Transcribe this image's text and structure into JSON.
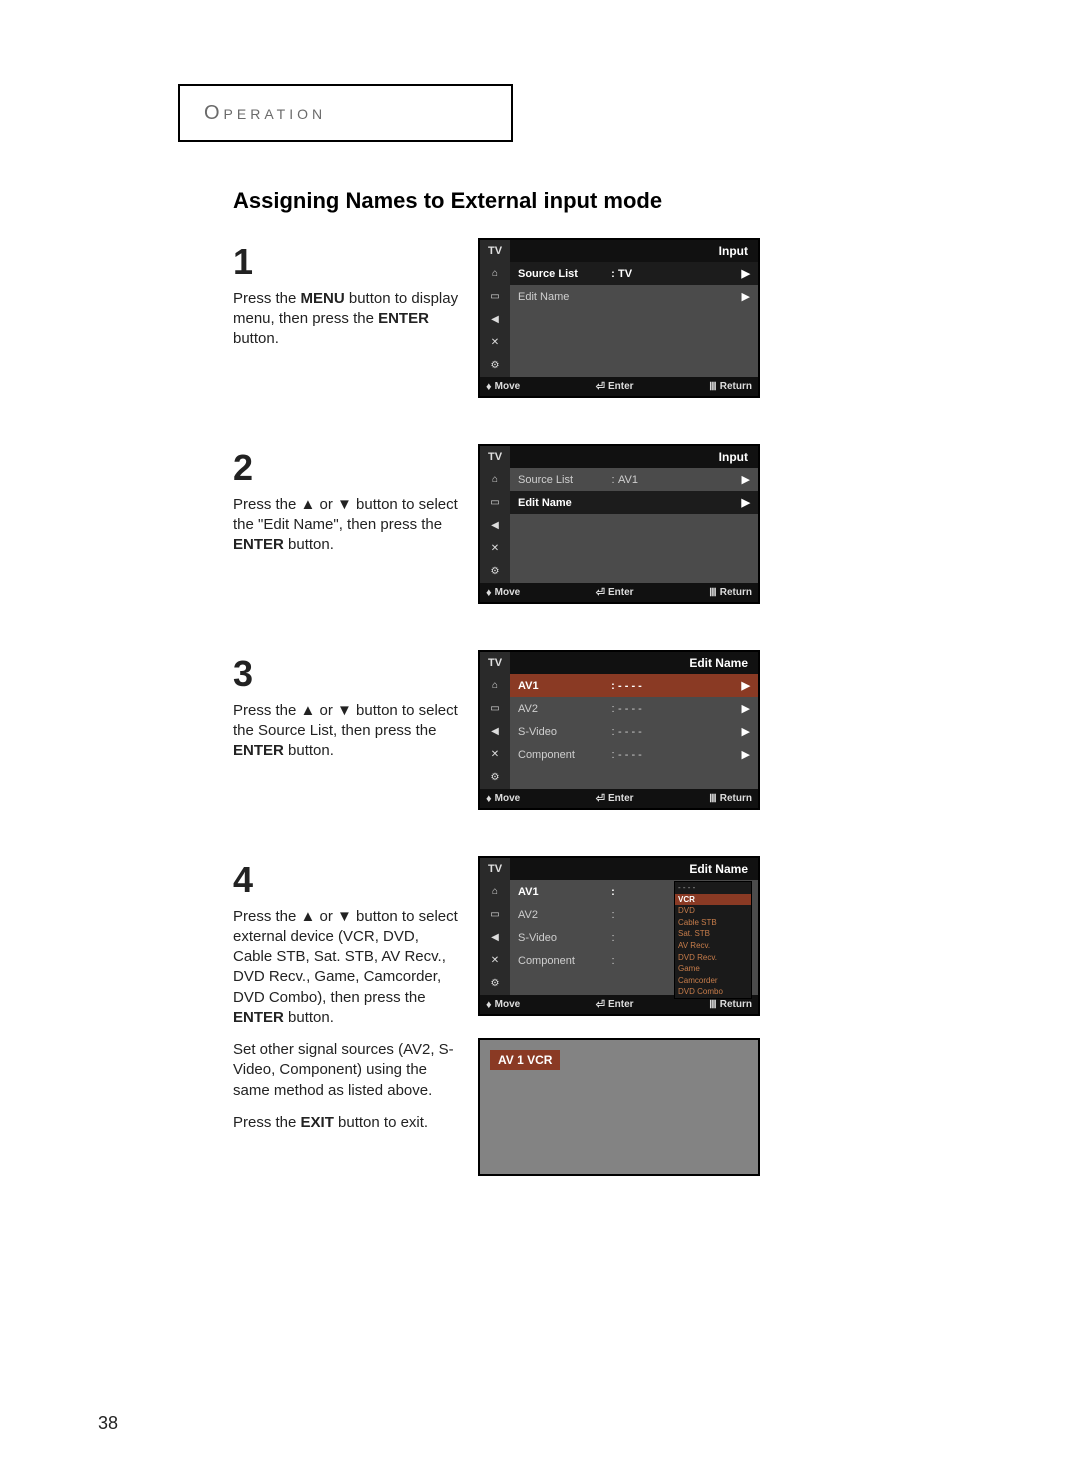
{
  "header": {
    "title": "Operation"
  },
  "section_title": "Assigning Names to External input mode",
  "page_number": "38",
  "osd_common": {
    "tv_label": "TV",
    "footer": {
      "move": "Move",
      "enter": "Enter",
      "return": "Return"
    }
  },
  "steps": [
    {
      "num": "1",
      "text_pre": "Press the ",
      "text_b1": "MENU",
      "text_mid": " button to display menu, then press the ",
      "text_b2": "ENTER",
      "text_post": " button.",
      "osd": {
        "title": "Input",
        "rows": [
          {
            "label": "Source List",
            "sep": ":",
            "val": "TV",
            "selected": true
          },
          {
            "label": "Edit Name",
            "sep": "",
            "val": "",
            "selected": false
          }
        ]
      }
    },
    {
      "num": "2",
      "text_pre": "Press the ▲ or ▼ button to select the \"Edit Name\", then press the ",
      "text_b1": "ENTER",
      "text_post": " button.",
      "osd": {
        "title": "Input",
        "rows": [
          {
            "label": "Source List",
            "sep": ":",
            "val": "AV1",
            "selected": false
          },
          {
            "label": "Edit Name",
            "sep": "",
            "val": "",
            "selected": true
          }
        ]
      }
    },
    {
      "num": "3",
      "text_pre": "Press the ▲ or ▼ button to select the Source List, then press the ",
      "text_b1": "ENTER",
      "text_post": " button.",
      "osd": {
        "title": "Edit Name",
        "rows": [
          {
            "label": "AV1",
            "sep": ":",
            "val": "- - - -",
            "selected": "orange"
          },
          {
            "label": "AV2",
            "sep": ":",
            "val": "- - - -",
            "selected": false
          },
          {
            "label": "S-Video",
            "sep": ":",
            "val": "- - - -",
            "selected": false
          },
          {
            "label": "Component",
            "sep": ":",
            "val": "- - - -",
            "selected": false
          }
        ]
      }
    },
    {
      "num": "4",
      "text_pre": "Press the ▲ or ▼ button to select external device (VCR, DVD, Cable STB, Sat. STB, AV Recv., DVD Recv., Game, Camcorder, DVD Combo), then press the ",
      "text_b1": "ENTER",
      "text_post": " button.",
      "para2": "Set other signal sources (AV2, S-Video, Component) using the same method as listed above.",
      "para3_pre": "Press the ",
      "para3_b": "EXIT",
      "para3_post": " button to exit.",
      "osd": {
        "title": "Edit Name",
        "rows": [
          {
            "label": "AV1",
            "sep": ":",
            "val": "",
            "selected": false,
            "bold": true
          },
          {
            "label": "AV2",
            "sep": ":",
            "val": "",
            "selected": false
          },
          {
            "label": "S-Video",
            "sep": ":",
            "val": "",
            "selected": false
          },
          {
            "label": "Component",
            "sep": ":",
            "val": "",
            "selected": false
          }
        ],
        "popup": {
          "header": "- - - -",
          "selected": "VCR",
          "items": [
            "DVD",
            "Cable STB",
            "Sat. STB",
            "AV Recv.",
            "DVD Recv.",
            "Game",
            "Camcorder",
            "DVD Combo"
          ]
        }
      },
      "result": "AV 1   VCR"
    }
  ]
}
